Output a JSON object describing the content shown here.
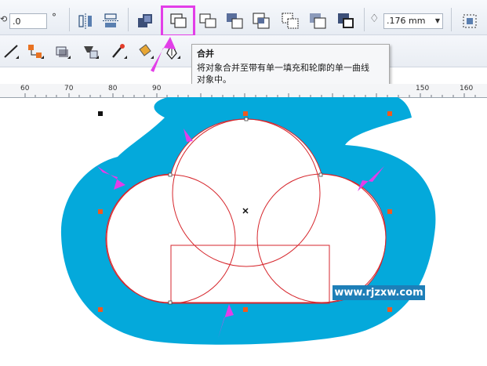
{
  "toolbar": {
    "angle_value": ".0",
    "degree_symbol": "°",
    "outline_width": ".176 mm",
    "icons": [
      "weld-icon",
      "trim-icon",
      "intersect-icon",
      "simplify-icon",
      "front-minus-back-icon",
      "back-minus-front-icon",
      "create-boundary-icon",
      "combine-icon",
      "break-apart-icon",
      "group-icon",
      "ungroup-icon",
      "align-icon",
      "distribute-icon"
    ]
  },
  "tooltip": {
    "title": "合并",
    "body_line1": "将对象合并至带有单一填充和轮廓的单一曲线",
    "body_line2": "对象中。"
  },
  "ruler": {
    "labels": [
      "60",
      "70",
      "80",
      "90",
      "150",
      "160"
    ]
  },
  "colors": {
    "shape_fill": "#04a9db",
    "outline": "#d6262c",
    "arrow": "#e23ee8",
    "node": "#f05a1e",
    "highlight": "#e23ee8"
  },
  "watermark": "www.rjzxw.com"
}
